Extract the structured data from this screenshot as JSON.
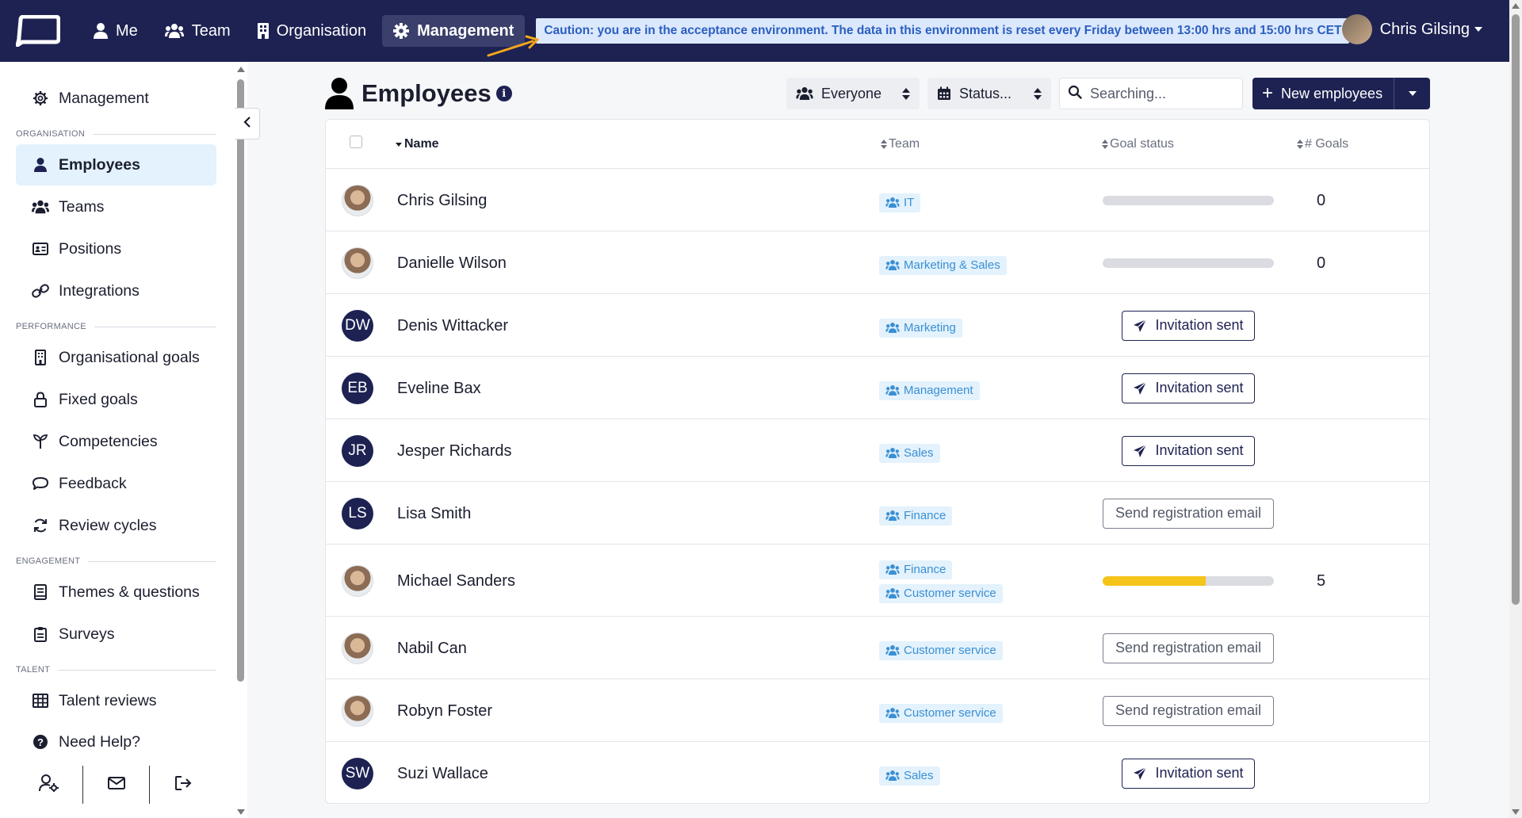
{
  "navbar": {
    "items": [
      {
        "label": "Me",
        "icon": "user-icon"
      },
      {
        "label": "Team",
        "icon": "users-icon"
      },
      {
        "label": "Organisation",
        "icon": "building-icon"
      },
      {
        "label": "Management",
        "icon": "gear-icon",
        "active": true
      }
    ],
    "caution": "Caution: you are in the acceptance environment. The data in this environment is reset every Friday between 13:00 hrs and 15:00 hrs CET",
    "user_name": "Chris Gilsing"
  },
  "sidebar": {
    "management": "Management",
    "sections": {
      "organisation": "ORGANISATION",
      "performance": "PERFORMANCE",
      "engagement": "ENGAGEMENT",
      "talent": "TALENT"
    },
    "items": {
      "employees": "Employees",
      "teams": "Teams",
      "positions": "Positions",
      "integrations": "Integrations",
      "organisational_goals": "Organisational goals",
      "fixed_goals": "Fixed goals",
      "competencies": "Competencies",
      "feedback": "Feedback",
      "review_cycles": "Review cycles",
      "themes_questions": "Themes & questions",
      "surveys": "Surveys",
      "talent_reviews": "Talent reviews",
      "need_help": "Need Help?"
    }
  },
  "header": {
    "title": "Employees",
    "filter_everyone": "Everyone",
    "filter_status": "Status...",
    "search_placeholder": "Searching...",
    "new_button": "New employees"
  },
  "table": {
    "columns": {
      "name": "Name",
      "team": "Team",
      "goal_status": "Goal status",
      "goals": "# Goals"
    },
    "rows": [
      {
        "name": "Chris Gilsing",
        "initials": "",
        "teams": [
          "IT"
        ],
        "status": "progress",
        "progress": 0,
        "goals": "0"
      },
      {
        "name": "Danielle Wilson",
        "initials": "",
        "teams": [
          "Marketing & Sales"
        ],
        "status": "progress",
        "progress": 0,
        "goals": "0"
      },
      {
        "name": "Denis Wittacker",
        "initials": "DW",
        "teams": [
          "Marketing"
        ],
        "status": "invited",
        "action": "Invitation sent"
      },
      {
        "name": "Eveline Bax",
        "initials": "EB",
        "teams": [
          "Management"
        ],
        "status": "invited",
        "action": "Invitation sent"
      },
      {
        "name": "Jesper Richards",
        "initials": "JR",
        "teams": [
          "Sales"
        ],
        "status": "invited",
        "action": "Invitation sent"
      },
      {
        "name": "Lisa Smith",
        "initials": "LS",
        "teams": [
          "Finance"
        ],
        "status": "register",
        "action": "Send registration email"
      },
      {
        "name": "Michael Sanders",
        "initials": "",
        "teams": [
          "Finance",
          "Customer service"
        ],
        "status": "progress",
        "progress": 0.6,
        "goals": "5"
      },
      {
        "name": "Nabil Can",
        "initials": "",
        "teams": [
          "Customer service"
        ],
        "status": "register",
        "action": "Send registration email"
      },
      {
        "name": "Robyn Foster",
        "initials": "",
        "teams": [
          "Customer service"
        ],
        "status": "register",
        "action": "Send registration email"
      },
      {
        "name": "Suzi Wallace",
        "initials": "SW",
        "teams": [
          "Sales"
        ],
        "status": "invited",
        "action": "Invitation sent"
      }
    ]
  },
  "colors": {
    "navy": "#1d2252",
    "badge_bg": "#e3f2fc",
    "badge_text": "#3b8fd4",
    "progress_fill": "#f5c418",
    "caution_bg": "#dce8fb"
  }
}
